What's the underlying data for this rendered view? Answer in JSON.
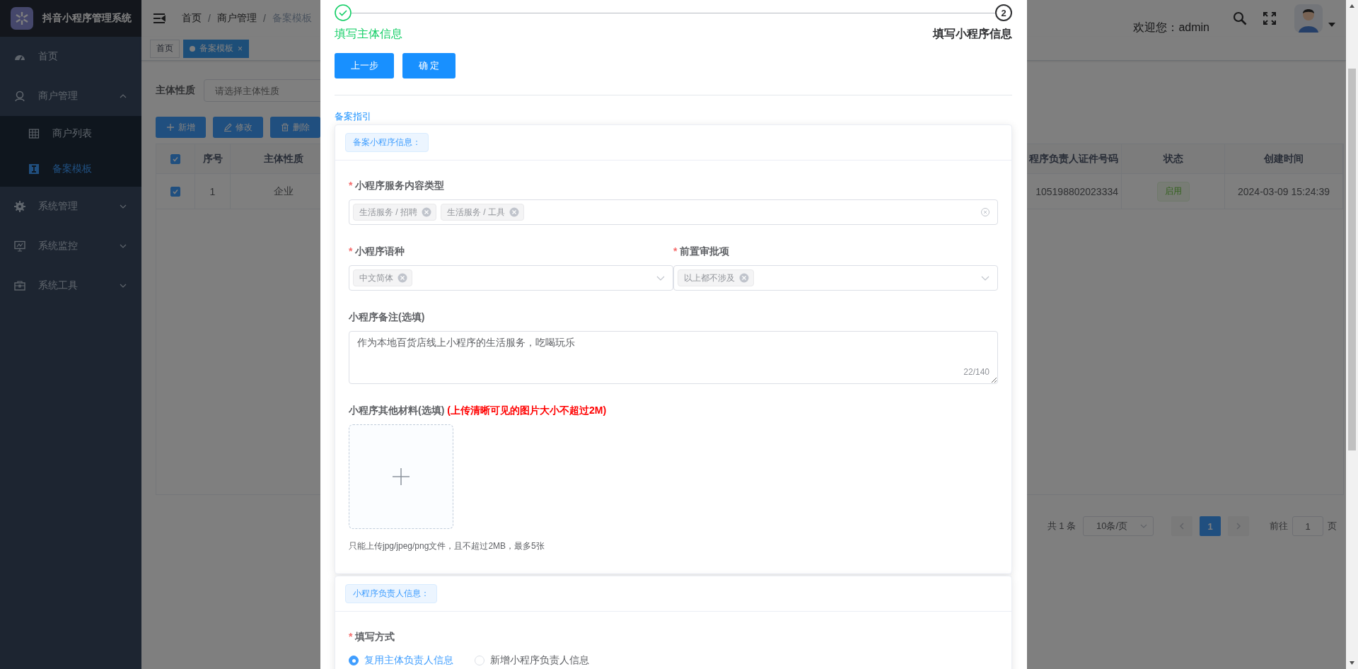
{
  "sidebar": {
    "title": "抖音小程序管理系统",
    "items": [
      {
        "label": "首页",
        "kind": "link",
        "selected": false
      },
      {
        "label": "商户管理",
        "kind": "group",
        "expanded": true,
        "selected": false,
        "children": [
          {
            "label": "商户列表",
            "selected": false
          },
          {
            "label": "备案模板",
            "selected": true
          }
        ]
      },
      {
        "label": "系统管理",
        "kind": "group",
        "expanded": false,
        "selected": false
      },
      {
        "label": "系统监控",
        "kind": "group",
        "expanded": false,
        "selected": false
      },
      {
        "label": "系统工具",
        "kind": "group",
        "expanded": false,
        "selected": false
      }
    ]
  },
  "header": {
    "breadcrumb": [
      {
        "label": "首页"
      },
      {
        "separator": "/",
        "label": "商户管理"
      },
      {
        "separator": "/",
        "label": "备案模板"
      }
    ],
    "welcome": "欢迎您：admin"
  },
  "tags": [
    {
      "label": "首页",
      "selected": false
    },
    {
      "label": "备案模板",
      "selected": true,
      "close": "×"
    }
  ],
  "filter": {
    "label": "主体性质",
    "placeholder": "请选择主体性质"
  },
  "toolbar": [
    {
      "label": "新增"
    },
    {
      "label": "修改"
    },
    {
      "label": "删除"
    }
  ],
  "table": {
    "select_all": {
      "checked": true
    },
    "columns": [
      {
        "kind": "text",
        "label": "序号"
      },
      {
        "kind": "text",
        "label": "主体性质"
      },
      {
        "kind": "text",
        "label": "程序负责人证件号码"
      },
      {
        "kind": "tag",
        "label": "状态"
      },
      {
        "kind": "text",
        "label": "创建时间"
      }
    ],
    "rows": [
      {
        "checked": true,
        "cells": [
          "1",
          "企业",
          "105198802023334",
          "启用",
          "2024-03-09 15:24:39"
        ]
      }
    ]
  },
  "pagination": {
    "total": "共 1 条",
    "page_size": "10条/页",
    "pages": [
      {
        "label": "1",
        "selected": true
      }
    ],
    "goto_label": "前往",
    "goto_value": "1",
    "goto_suffix": "页"
  },
  "modal": {
    "steps": [
      {
        "label": "填写主体信息",
        "done": true
      },
      {
        "label": "填写小程序信息",
        "number": "2",
        "done": false
      }
    ],
    "buttons": [
      "上一步",
      "确 定"
    ],
    "guide_link": "备案指引",
    "sections": [
      {
        "title": "备案小程序信息：",
        "fields": [
          {
            "kind": "multiselect",
            "asterisk": "*",
            "label": "小程序服务内容类型",
            "tags": [
              "生活服务 / 招聘",
              "生活服务 / 工具"
            ]
          },
          {
            "kind": "row",
            "fields": [
              {
                "kind": "select",
                "asterisk": "*",
                "label": "小程序语种",
                "tags": [
                  "中文简体"
                ]
              },
              {
                "kind": "select",
                "asterisk": "*",
                "label": "前置审批项",
                "tags": [
                  "以上都不涉及"
                ]
              }
            ]
          },
          {
            "kind": "textarea",
            "label": "小程序备注(选填)",
            "value": "作为本地百货店线上小程序的生活服务，吃喝玩乐",
            "counter": "22/140"
          },
          {
            "kind": "upload",
            "label": "小程序其他材料(选填)",
            "note": "(上传清晰可见的图片大小不超过2M)",
            "hint": "只能上传jpg/jpeg/png文件，且不超过2MB，最多5张"
          }
        ]
      },
      {
        "title": "小程序负责人信息：",
        "fields": [
          {
            "kind": "radio",
            "asterisk": "*",
            "label": "填写方式",
            "options": [
              {
                "label": "复用主体负责人信息",
                "selected": true
              },
              {
                "label": "新增小程序负责人信息",
                "selected": false
              }
            ]
          }
        ]
      }
    ]
  }
}
